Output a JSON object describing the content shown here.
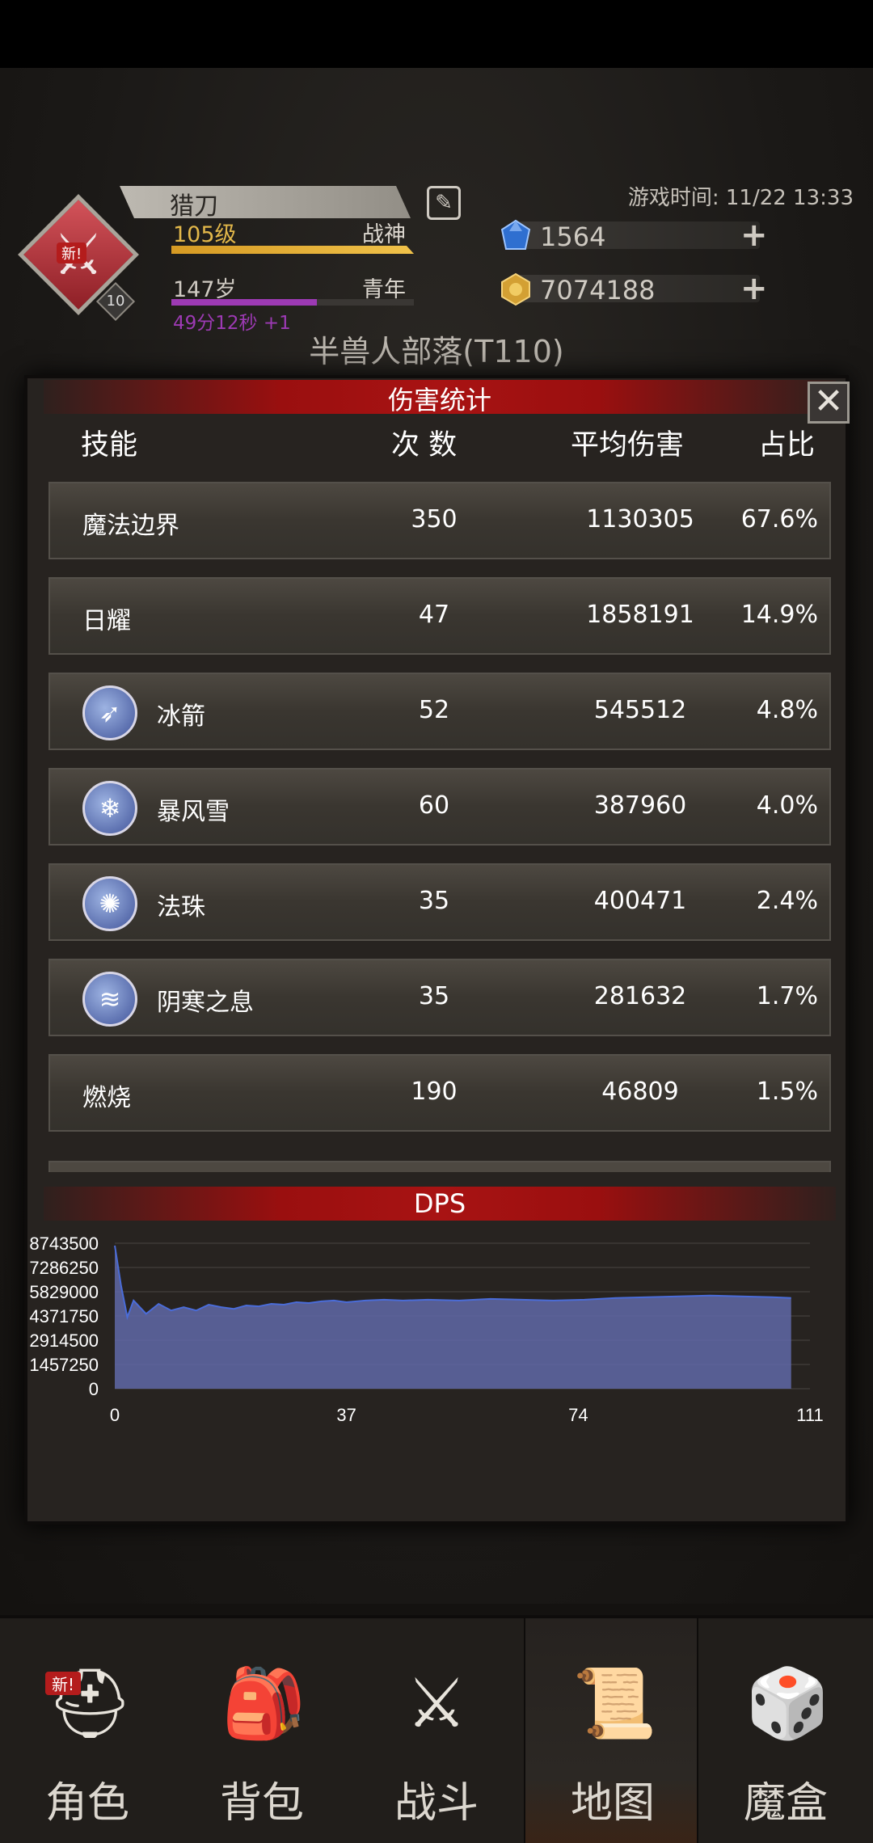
{
  "header": {
    "name": "猎刀",
    "level": "105级",
    "title": "战神",
    "age": "147岁",
    "life_stage": "青年",
    "age_timer": "49分12秒 +1",
    "badge_level": "10",
    "new_tag": "新!",
    "game_time": "游戏时间: 11/22 13:33",
    "diamonds": "1564",
    "gold": "7074188",
    "region": "半兽人部落(T110)"
  },
  "modal": {
    "title": "伤害统计",
    "columns": [
      "技能",
      "次 数",
      "平均伤害",
      "占比"
    ],
    "rows": [
      {
        "skill": "魔法边界",
        "count": "350",
        "avg": "1130305",
        "pct": "67.6%",
        "icon": null
      },
      {
        "skill": "日耀",
        "count": "47",
        "avg": "1858191",
        "pct": "14.9%",
        "icon": null
      },
      {
        "skill": "冰箭",
        "count": "52",
        "avg": "545512",
        "pct": "4.8%",
        "icon": "ice-arrow-icon"
      },
      {
        "skill": "暴风雪",
        "count": "60",
        "avg": "387960",
        "pct": "4.0%",
        "icon": "blizzard-icon"
      },
      {
        "skill": "法珠",
        "count": "35",
        "avg": "400471",
        "pct": "2.4%",
        "icon": "orb-icon"
      },
      {
        "skill": "阴寒之息",
        "count": "35",
        "avg": "281632",
        "pct": "1.7%",
        "icon": "frost-breath-icon"
      },
      {
        "skill": "燃烧",
        "count": "190",
        "avg": "46809",
        "pct": "1.5%",
        "icon": null
      }
    ],
    "dps_title": "DPS"
  },
  "chart_data": {
    "type": "area",
    "title": "DPS",
    "y_ticks": [
      "8743500",
      "7286250",
      "5829000",
      "4371750",
      "2914500",
      "1457250",
      "0"
    ],
    "x_ticks": [
      "0",
      "37",
      "74",
      "111"
    ],
    "ylim": [
      0,
      8743500
    ],
    "xlim": [
      0,
      111
    ],
    "grid": true,
    "color": "#6068a8",
    "line_color": "#4a6cd8",
    "x": [
      0,
      1,
      2,
      3,
      5,
      7,
      9,
      11,
      13,
      15,
      17,
      19,
      21,
      23,
      25,
      27,
      29,
      31,
      33,
      35,
      37,
      40,
      43,
      46,
      50,
      55,
      60,
      65,
      70,
      75,
      80,
      85,
      90,
      95,
      100,
      105,
      108
    ],
    "values": [
      8600000,
      6200000,
      4300000,
      5300000,
      4500000,
      5100000,
      4700000,
      4900000,
      4700000,
      5050000,
      4900000,
      4800000,
      5000000,
      4950000,
      5100000,
      5050000,
      5200000,
      5150000,
      5250000,
      5300000,
      5200000,
      5300000,
      5350000,
      5300000,
      5350000,
      5300000,
      5400000,
      5350000,
      5300000,
      5350000,
      5450000,
      5500000,
      5550000,
      5600000,
      5550000,
      5500000,
      5450000
    ]
  },
  "nav": {
    "items": [
      {
        "label": "角色",
        "icon": "helmet-icon"
      },
      {
        "label": "背包",
        "icon": "backpack-icon"
      },
      {
        "label": "战斗",
        "icon": "sword-shield-icon"
      },
      {
        "label": "地图",
        "icon": "scroll-map-icon"
      },
      {
        "label": "魔盒",
        "icon": "magic-box-icon"
      }
    ],
    "active_index": 3,
    "new_tag": "新!"
  }
}
